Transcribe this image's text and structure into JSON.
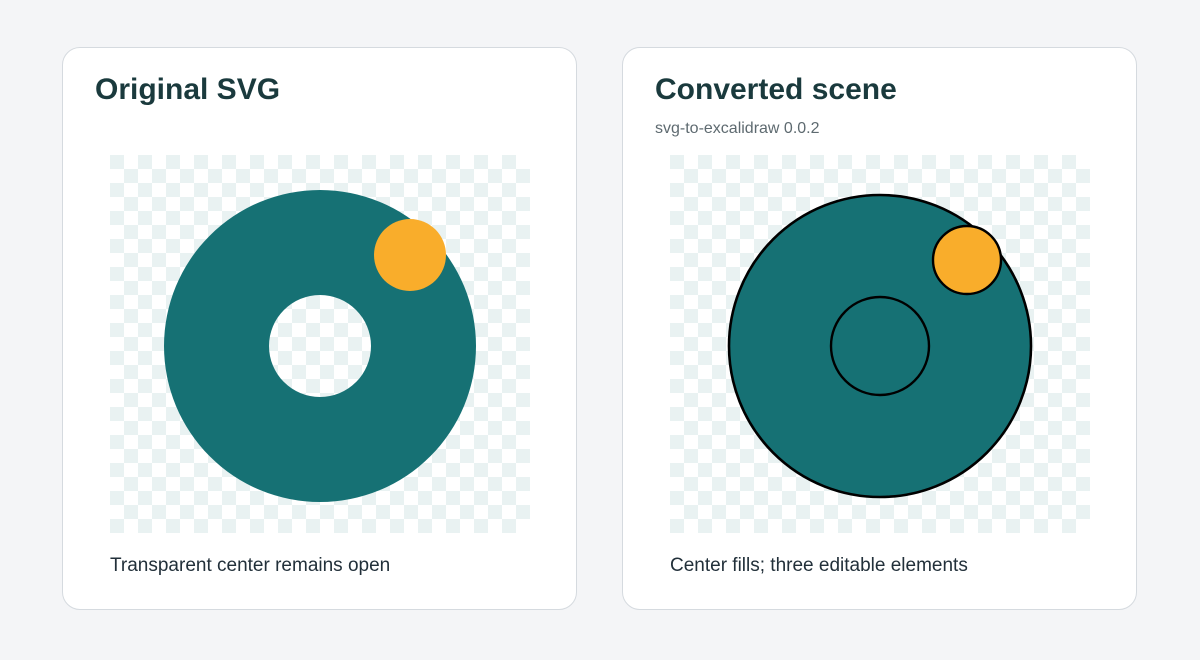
{
  "colors": {
    "page_background": "#f4f5f7",
    "card_background": "#ffffff",
    "card_border": "#d5dadf",
    "teal_fill": "#167174",
    "orange_fill": "#f9ad2b",
    "stroke": "#000000",
    "checker_light": "#ffffff",
    "checker_dark": "#e9f2f2",
    "title_text": "#1a3a3d"
  },
  "original_panel": {
    "title": "Original SVG",
    "caption": "Transparent center remains open"
  },
  "converted_panel": {
    "title": "Converted scene",
    "subtitle": "svg-to-excalidraw 0.0.2",
    "caption": "Center fills; three editable elements"
  }
}
